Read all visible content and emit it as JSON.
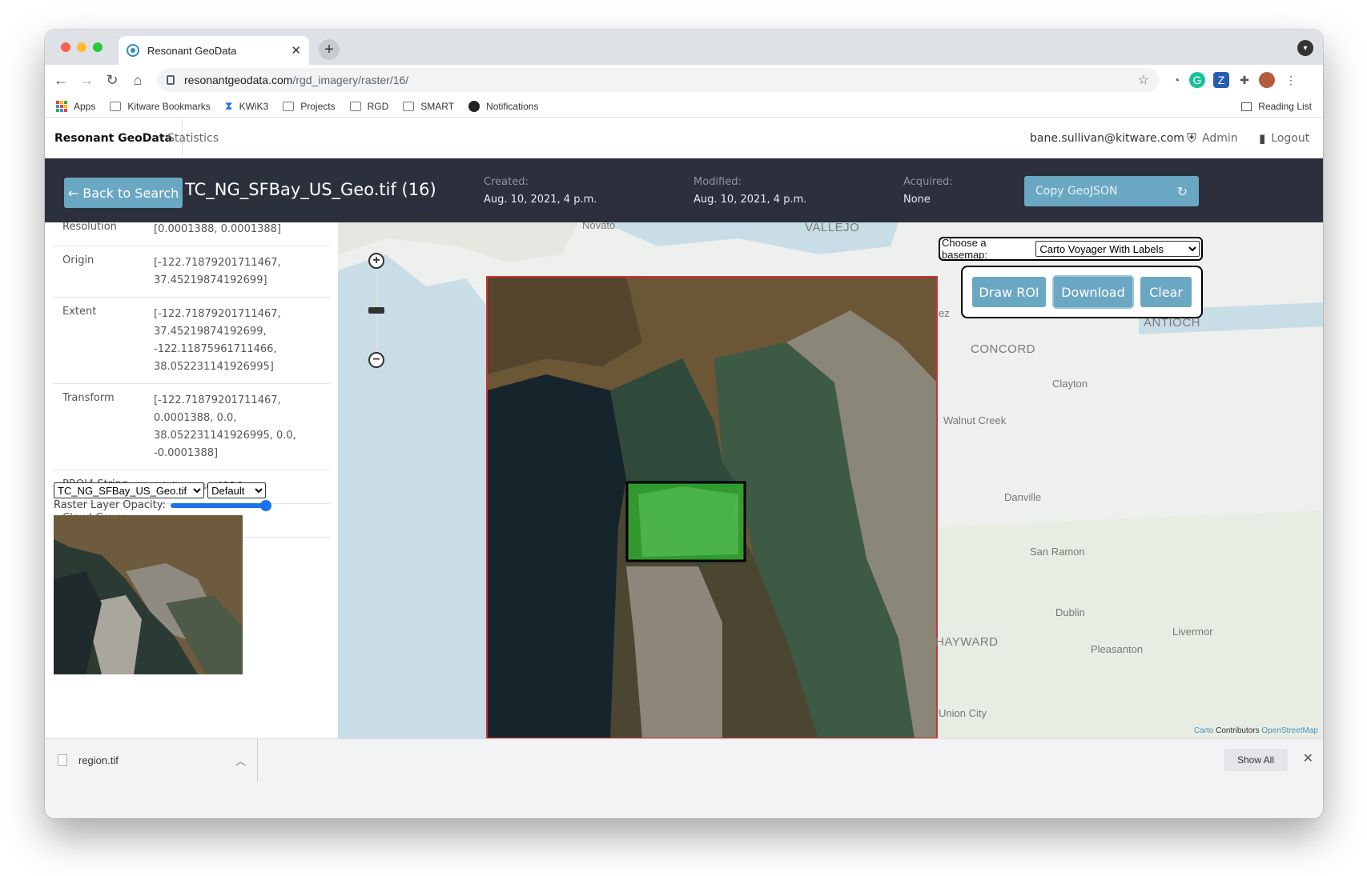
{
  "browser": {
    "tab_title": "Resonant GeoData",
    "tab_close": "✕",
    "new_tab": "+",
    "url_host": "resonantgeodata.com",
    "url_path": "/rgd_imagery/raster/16/",
    "bookmarks": [
      "Apps",
      "Kitware Bookmarks",
      "KWiK3",
      "Projects",
      "RGD",
      "SMART",
      "Notifications"
    ],
    "reading_list": "Reading List"
  },
  "app": {
    "brand": "Resonant GeoData",
    "nav_statistics": "Statistics",
    "user_email": "bane.sullivan@kitware.com",
    "admin": "Admin",
    "logout": "Logout"
  },
  "header": {
    "back_label": "← Back to Search",
    "title": "TC_NG_SFBay_US_Geo.tif (16)",
    "created_label": "Created:",
    "created_value": "Aug. 10, 2021, 4 p.m.",
    "modified_label": "Modified:",
    "modified_value": "Aug. 10, 2021, 4 p.m.",
    "acquired_label": "Acquired:",
    "acquired_value": "None",
    "copy_geojson": "Copy GeoJSON"
  },
  "properties": [
    {
      "key": "Resolution",
      "value": "[0.0001388, 0.0001388]"
    },
    {
      "key": "Origin",
      "value": "[-122.71879201711467,\n37.45219874192699]"
    },
    {
      "key": "Extent",
      "value": "[-122.71879201711467,\n37.45219874192699,\n-122.11875961711466,\n38.052231141926995]"
    },
    {
      "key": "Transform",
      "value": "[-122.71879201711467, 0.0001388, 0.0,\n38.052231141926995, 0.0, -0.0001388]"
    },
    {
      "key": "PROJ4 String",
      "value": "+init=epsg:4326"
    },
    {
      "key": "Cloud Cover",
      "value": "None"
    }
  ],
  "layer_controls": {
    "file_select": "TC_NG_SFBay_US_Geo.tif",
    "style_select": "Default",
    "opacity_label": "Raster Layer Opacity:",
    "opacity": 1.0
  },
  "map": {
    "basemap_label": "Choose a basemap:",
    "basemap_value": "Carto Voyager With Labels",
    "draw_roi": "Draw ROI",
    "download": "Download",
    "clear": "Clear",
    "labels": [
      "Novato",
      "VALLEJO",
      "CONCORD",
      "Clayton",
      "Walnut Creek",
      "ANTIOCH",
      "Danville",
      "San Ramon",
      "Dublin",
      "Livermor",
      "Pleasanton",
      "HAYWARD",
      "Union City",
      "ez"
    ],
    "attribution_carto": "Carto",
    "attribution_contrib": "Contributors",
    "attribution_osm": "OpenStreetMap"
  },
  "downloads": {
    "file": "region.tif",
    "show_all": "Show All",
    "close": "✕"
  }
}
